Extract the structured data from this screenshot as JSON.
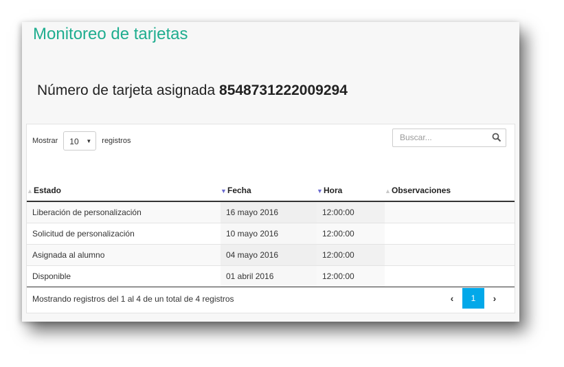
{
  "page_title": "Monitoreo de tarjetas",
  "card_label": "Número de tarjeta asignada",
  "card_number": "8548731222009294",
  "length": {
    "prefix": "Mostrar",
    "value": "10",
    "suffix": "registros"
  },
  "search": {
    "placeholder": "Buscar...",
    "icon": "search-icon"
  },
  "table": {
    "columns": [
      "Estado",
      "Fecha",
      "Hora",
      "Observaciones"
    ],
    "rows": [
      [
        "Liberación de personalización",
        "16 mayo 2016",
        "12:00:00",
        ""
      ],
      [
        "Solicitud de personalización",
        "10 mayo 2016",
        "12:00:00",
        ""
      ],
      [
        "Asignada al alumno",
        "04 mayo 2016",
        "12:00:00",
        ""
      ],
      [
        "Disponible",
        "01 abril 2016",
        "12:00:00",
        ""
      ]
    ]
  },
  "info": "Mostrando registros del 1 al 4 de un total de 4 registros",
  "pagination": {
    "prev": "‹",
    "current": "1",
    "next": "›"
  },
  "colors": {
    "title": "#1fad8f",
    "page_active": "#02a8e9",
    "sort_arrow": "#6b6bd0"
  }
}
